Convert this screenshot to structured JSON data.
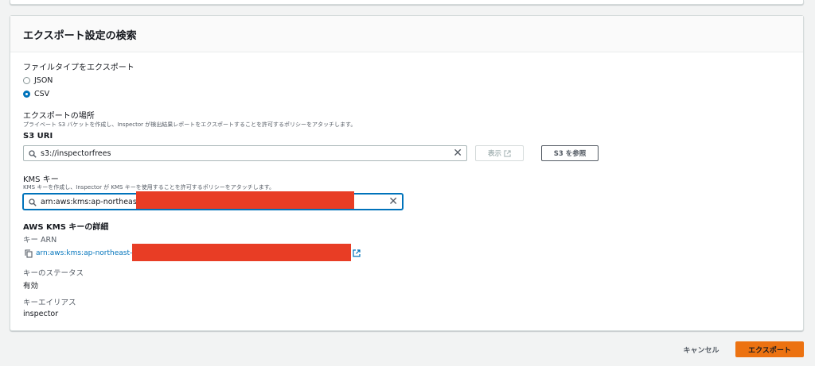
{
  "panel": {
    "title": "エクスポート設定の検索"
  },
  "file_type": {
    "label": "ファイルタイプをエクスポート",
    "options": [
      {
        "label": "JSON",
        "checked": false
      },
      {
        "label": "CSV",
        "checked": true
      }
    ]
  },
  "export_location": {
    "label": "エクスポートの場所",
    "description": "プライベート S3 バケットを作成し、Inspector が検出結果レポートをエクスポートすることを許可するポリシーをアタッチします。"
  },
  "s3_uri": {
    "label": "S3 URI",
    "value": "s3://inspectorfrees",
    "view_button": "表示",
    "browse_button": "S3 を参照"
  },
  "kms_key": {
    "label": "KMS キー",
    "description": "KMS キーを作成し、Inspector が KMS キーを使用することを許可するポリシーをアタッチします。",
    "value": "arn:aws:kms:ap-northeast-1"
  },
  "kms_details": {
    "heading": "AWS KMS キーの詳細",
    "arn_label": "キー ARN",
    "arn_value": "arn:aws:kms:ap-northeast-1",
    "status_label": "キーのステータス",
    "status_value": "有効",
    "alias_label": "キーエイリアス",
    "alias_value": "inspector"
  },
  "footer": {
    "cancel_button": "キャンセル",
    "export_button": "エクスポート"
  },
  "colors": {
    "primary_button": "#ec7211",
    "link": "#0073bb",
    "redaction": "#e83d25"
  },
  "icons": [
    "search-icon",
    "clear-icon",
    "external-link-icon",
    "copy-icon"
  ]
}
